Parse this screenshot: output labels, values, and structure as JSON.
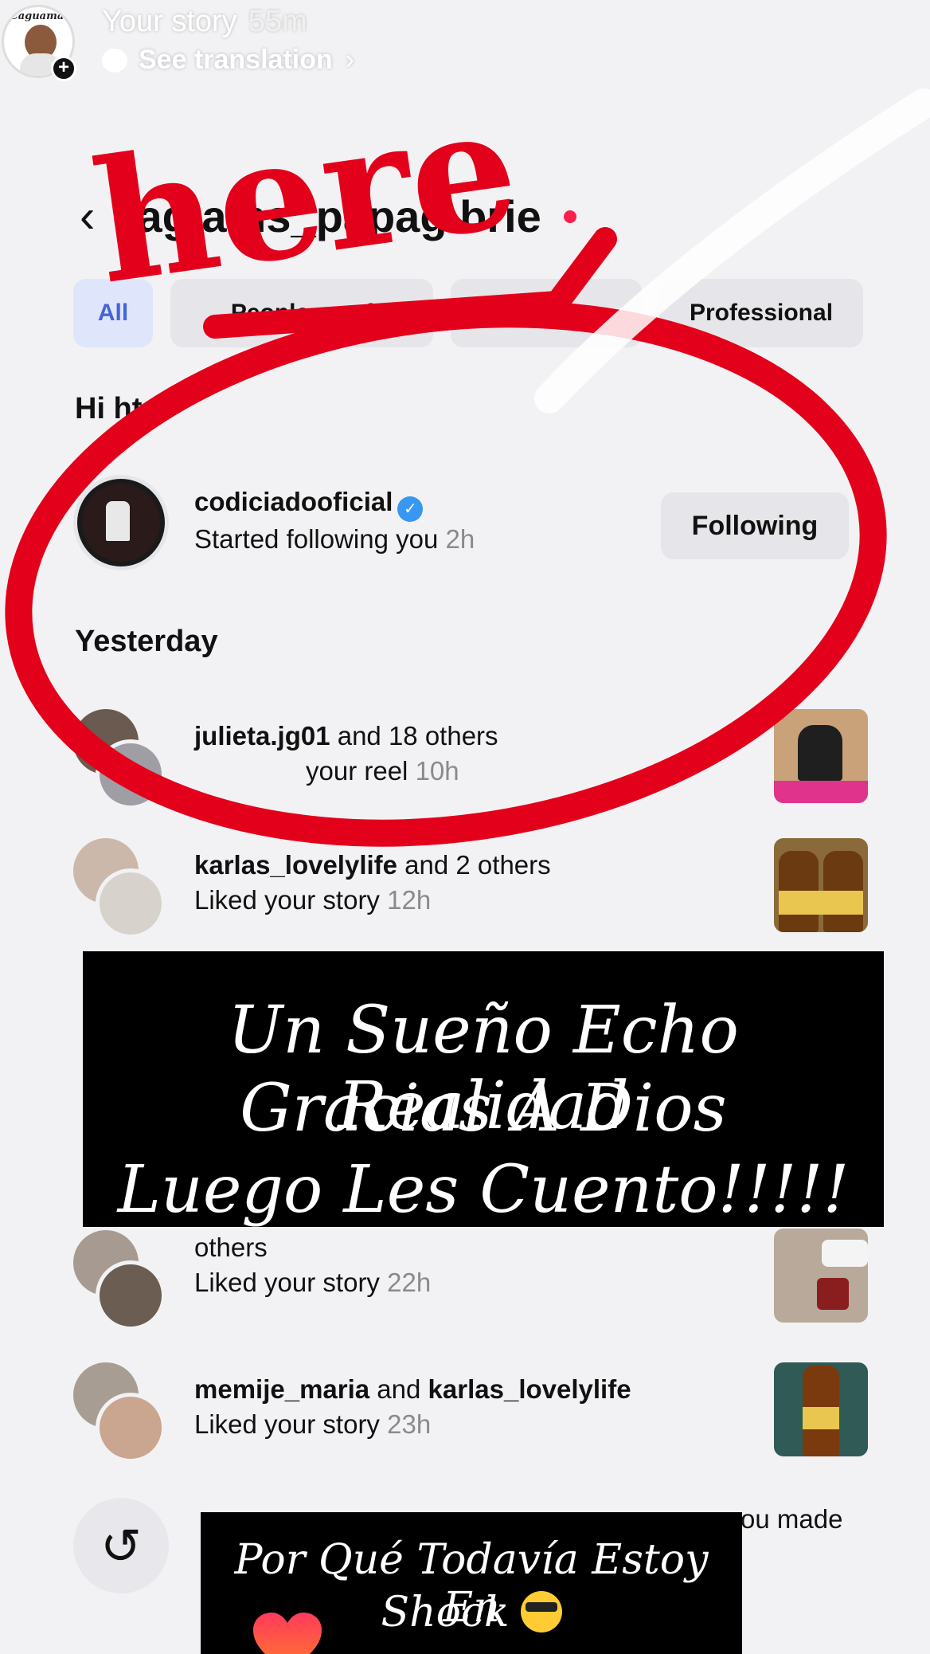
{
  "story": {
    "title": "Your story",
    "time": "55m",
    "translate": "See translation"
  },
  "profile": {
    "username": "cag  ams_papag  brie"
  },
  "tabs": [
    "All",
    "People you f",
    "",
    "Professional"
  ],
  "sections": {
    "highlights": "Hi   hts",
    "yesterday": "Yesterday"
  },
  "notifications": [
    {
      "user": "codiciadooficial",
      "rest": "",
      "action": "Started following you",
      "ago": "2h",
      "button": "Following"
    },
    {
      "user": "julieta.jg01",
      "rest": " and 18 others",
      "action": "your reel",
      "ago": "10h"
    },
    {
      "user": "karlas_lovelylife",
      "rest": " and 2 others",
      "action": "Liked your story",
      "ago": "12h"
    },
    {
      "user": "",
      "rest": "others",
      "action": "Liked your story",
      "ago": "22h"
    },
    {
      "user": "memije_maria",
      "rest": " and ",
      "user2": "karlas_lovelylife",
      "action": "Liked your story",
      "ago": "23h"
    }
  ],
  "partial_text": "ou made",
  "captions": {
    "main": [
      "Un Sueño Echo Realidad",
      "Gracias A Dios",
      "Luego Les Cuento!!!!!"
    ],
    "bottom": [
      "Por Qué Todavía Estoy En",
      "Shock"
    ]
  },
  "annotation": {
    "word": "here",
    "color": "#e3001b"
  },
  "icons": [
    "plus-icon",
    "translate-bubble-icon",
    "chevron-right-icon",
    "back-chevron-icon",
    "verified-icon",
    "history-icon",
    "heart-icon",
    "sunglasses-emoji"
  ]
}
